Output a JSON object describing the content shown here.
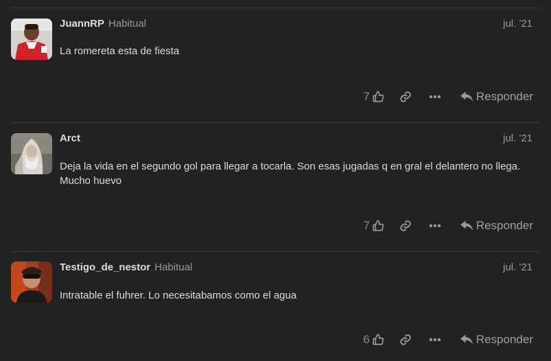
{
  "posts": [
    {
      "username": "JuannRP",
      "user_title": "Habitual",
      "date": "jul. '21",
      "body": [
        "La romereta esta de fiesta"
      ],
      "likes": "7",
      "reply_label": "Responder",
      "avatar": "avatar-red-jersey-player"
    },
    {
      "username": "Arct",
      "user_title": "",
      "date": "jul. '21",
      "body": [
        "Deja la vida en el segundo gol para llegar a tocarla. Son esas jugadas q en gral el delantero no llega.",
        "Mucho huevo"
      ],
      "likes": "7",
      "reply_label": "Responder",
      "avatar": "avatar-grey-wizard"
    },
    {
      "username": "Testigo_de_nestor",
      "user_title": "Habitual",
      "date": "jul. '21",
      "body": [
        "Intratable el fuhrer. Lo necesitabamos como el agua"
      ],
      "likes": "6",
      "reply_label": "Responder",
      "avatar": "avatar-man-sunglasses"
    }
  ],
  "icons": {
    "like": "thumbs-up-icon",
    "link": "link-icon",
    "more": "ellipsis-icon",
    "reply": "reply-arrow-icon"
  },
  "colors": {
    "background": "#222222",
    "text": "#dddddd",
    "muted": "#9a9a9a",
    "divider": "#393939"
  }
}
